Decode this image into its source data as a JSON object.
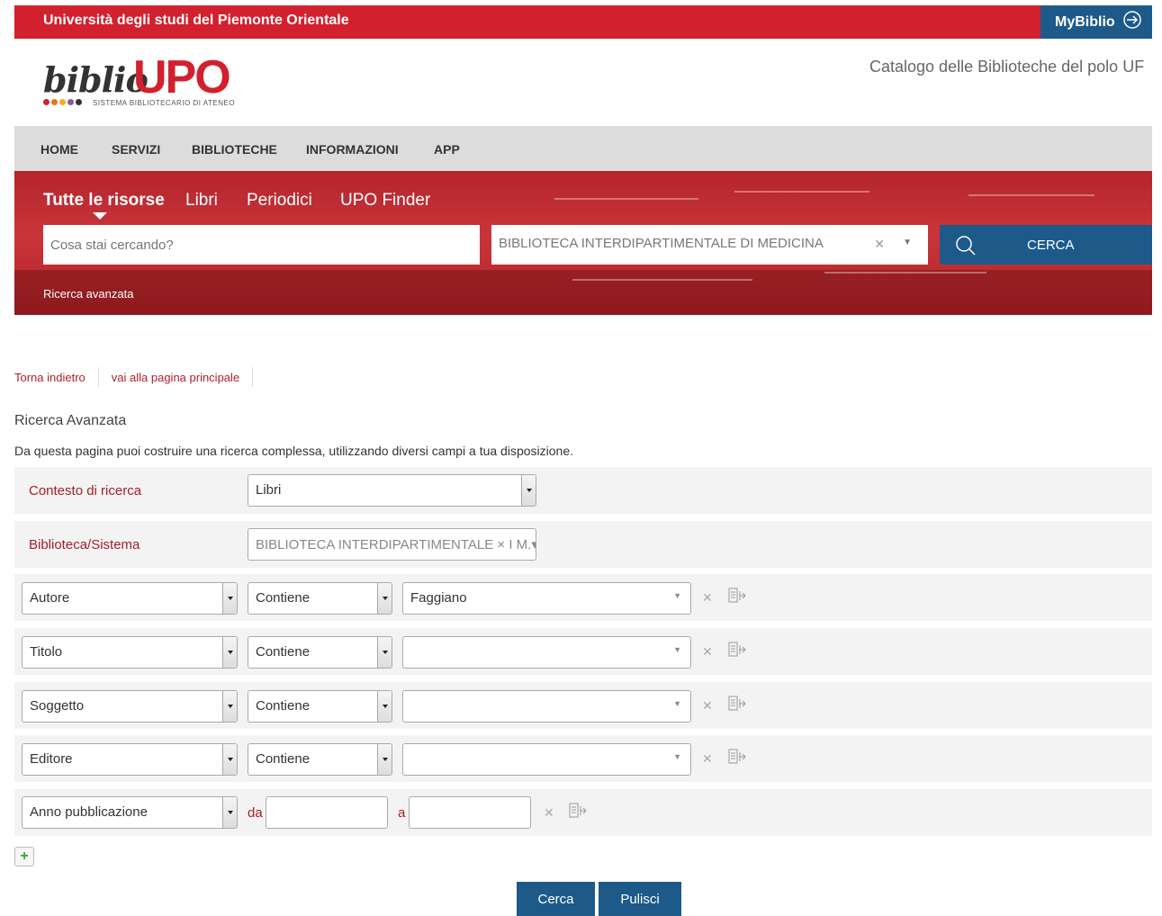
{
  "header": {
    "university": "Università degli studi del Piemonte Orientale",
    "mybiblio": "MyBiblio",
    "logo_text": "biblio",
    "logo_brand": "UPO",
    "logo_tagline": "SISTEMA BIBLIOTECARIO DI ATENEO",
    "catalog_title": "Catalogo delle Biblioteche del polo UF"
  },
  "nav": {
    "items": [
      "HOME",
      "SERVIZI",
      "BIBLIOTECHE",
      "INFORMAZIONI",
      "APP"
    ]
  },
  "hero": {
    "tabs": [
      "Tutte le risorse",
      "Libri",
      "Periodici",
      "UPO Finder"
    ],
    "active_tab": "Tutte le risorse",
    "search_placeholder": "Cosa stai cercando?",
    "library_value": "BIBLIOTECA INTERDIPARTIMENTALE DI MEDICINA",
    "search_button": "CERCA",
    "advanced_link": "Ricerca avanzata"
  },
  "breadcrumbs": [
    "Torna indietro",
    "vai alla pagina principale"
  ],
  "page": {
    "title": "Ricerca Avanzata",
    "intro": "Da questa pagina puoi costruire una ricerca complessa, utilizzando diversi campi a tua disposizione."
  },
  "form": {
    "context_label": "Contesto di ricerca",
    "context_value": "Libri",
    "library_label": "Biblioteca/Sistema",
    "library_value": "BIBLIOTECA INTERDIPARTIMENTALE × I M.▾ DI",
    "rows": [
      {
        "field": "Autore",
        "operator": "Contiene",
        "value": "Faggiano"
      },
      {
        "field": "Titolo",
        "operator": "Contiene",
        "value": ""
      },
      {
        "field": "Soggetto",
        "operator": "Contiene",
        "value": ""
      },
      {
        "field": "Editore",
        "operator": "Contiene",
        "value": ""
      }
    ],
    "year_field": "Anno pubblicazione",
    "year_from_label": "da",
    "year_to_label": "a",
    "add_button": "+",
    "search_button": "Cerca",
    "clear_button": "Pulisci"
  },
  "colors": {
    "brand_red": "#d3202e",
    "brand_blue": "#1d5a8a",
    "label_red": "#a51e2a"
  }
}
